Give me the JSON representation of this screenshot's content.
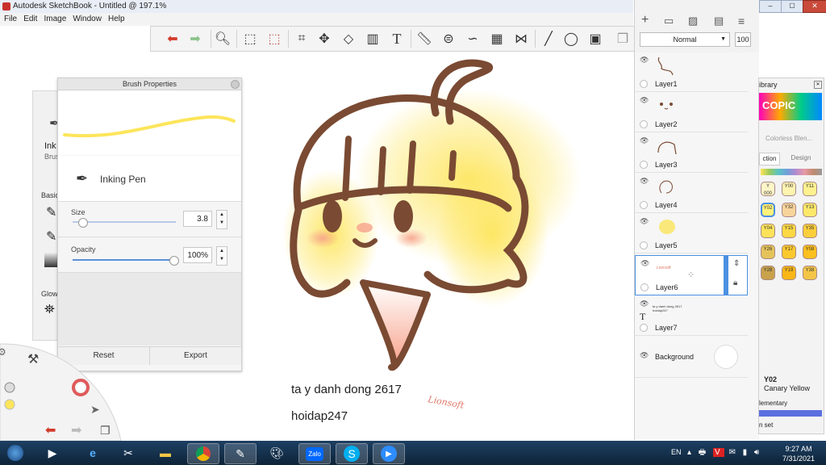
{
  "window": {
    "title": "Autodesk SketchBook - Untitled @ 197.1%"
  },
  "menu": [
    "File",
    "Edit",
    "Image",
    "Window",
    "Help"
  ],
  "toolbar": {
    "icons": [
      "undo-icon",
      "redo-icon",
      "zoom-icon",
      "selection-icon",
      "transform-select-icon",
      "crop-icon",
      "distort-icon",
      "perspective-icon",
      "symmetry-icon",
      "text-icon",
      "ruler-icon",
      "ellipse-guide-icon",
      "french-curve-icon",
      "perspective-guide-icon",
      "symmetry-x-icon",
      "stroke-icon",
      "circle-icon",
      "shape-icon",
      "copy-icon"
    ]
  },
  "brush_properties": {
    "title": "Brush Properties",
    "brush_name": "Inking Pen",
    "size_label": "Size",
    "size_value": "3.8",
    "size_fraction": 0.06,
    "opacity_label": "Opacity",
    "opacity_value": "100%",
    "opacity_fraction": 1.0,
    "reset_label": "Reset",
    "export_label": "Export"
  },
  "left_strip": {
    "ink_label": "Ink",
    "brush_label": "Brus",
    "basic_label": "Basic",
    "glow_label": "Glow"
  },
  "layers_panel": {
    "blend_mode": "Normal",
    "opacity_value": "100",
    "layers": [
      {
        "name": "Layer1"
      },
      {
        "name": "Layer2"
      },
      {
        "name": "Layer3"
      },
      {
        "name": "Layer4"
      },
      {
        "name": "Layer5"
      },
      {
        "name": "Layer6",
        "selected": true,
        "thumb_text": "Lionsoft"
      },
      {
        "name": "Layer7",
        "thumb_text": "ta y danh dong 2617\nhoidap247"
      },
      {
        "name": "Background"
      }
    ]
  },
  "copic": {
    "title": "ibrary",
    "logo": "COPIC",
    "colorless": "Colorless Blen...",
    "tab_collection": "ction",
    "tab_design": "Design",
    "swatches": [
      {
        "code": "Y\n000",
        "color": "#fff6c8"
      },
      {
        "code": "Y00",
        "color": "#fff3b0"
      },
      {
        "code": "Y11",
        "color": "#fff18f"
      },
      {
        "code": "Y02",
        "color": "#fff27a"
      },
      {
        "code": "Y32",
        "color": "#f7d49a"
      },
      {
        "code": "Y13",
        "color": "#fde86a"
      },
      {
        "code": "Y04",
        "color": "#fde35a"
      },
      {
        "code": "Y15",
        "color": "#fcd843"
      },
      {
        "code": "Y35",
        "color": "#fbcf3b"
      },
      {
        "code": "Y26",
        "color": "#e4c35a"
      },
      {
        "code": "Y17",
        "color": "#fbc92e"
      },
      {
        "code": "Y08",
        "color": "#fbbf1e"
      },
      {
        "code": "Y28",
        "color": "#c9a24b"
      },
      {
        "code": "Y19",
        "color": "#f8b617"
      },
      {
        "code": "Y38",
        "color": "#f3c547"
      }
    ],
    "selected_code": "Y02",
    "selected_name": "Canary Yellow",
    "family": "lementary",
    "set_label": "n set"
  },
  "canvas": {
    "text_line1": "ta y danh dong 2617",
    "text_line2": "hoidap247",
    "signature": "Lionsoft"
  },
  "taskbar": {
    "lang": "EN",
    "time": "9:27 AM",
    "date": "7/31/2021",
    "apps": [
      "start-icon",
      "media-player-icon",
      "ie-icon",
      "snipping-tool-icon",
      "explorer-icon",
      "chrome-icon",
      "sketchbook-icon",
      "paint-icon",
      "zalo-icon",
      "skype-icon",
      "zoom-icon"
    ]
  },
  "colors": {
    "hair_outline": "#7a4a33",
    "hair_fill": "#fde55b",
    "blush": "#f6a28b",
    "accent": "#4a90e2"
  }
}
